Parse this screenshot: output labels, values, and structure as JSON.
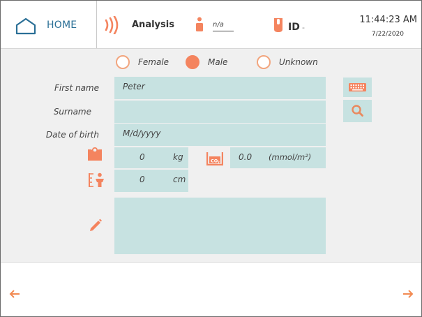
{
  "header": {
    "home_label": "HOME",
    "analysis_label": "Analysis",
    "patient_value": "n/a",
    "id_label": "ID",
    "id_value": "-",
    "time": "11:44:23 AM",
    "date": "7/22/2020"
  },
  "gender": {
    "options": [
      "Female",
      "Male",
      "Unknown"
    ],
    "selected": "Male"
  },
  "form": {
    "first_name_label": "First name",
    "first_name_value": "Peter",
    "surname_label": "Surname",
    "surname_value": "",
    "dob_label": "Date of birth",
    "dob_placeholder": "M/d/yyyy",
    "weight_value": "0",
    "weight_unit": "kg",
    "co2_value": "0.0",
    "co2_unit": "(mmol/m²)",
    "height_value": "0",
    "height_unit": "cm",
    "notes_value": ""
  },
  "icons": {
    "home": "home-icon",
    "analysis": "wave-signal-icon",
    "patient": "person-icon",
    "sample": "tube-icon",
    "keyboard": "keyboard-icon",
    "search": "search-icon",
    "weight": "weight-scale-icon",
    "co2": "co2-icon",
    "height": "height-person-icon",
    "notes": "pencil-icon",
    "back": "arrow-left-icon",
    "next": "arrow-right-icon"
  },
  "colors": {
    "accent": "#f4845f",
    "field_bg": "#c7e2e1",
    "home_blue": "#2a6f96",
    "search_icon": "#e9895e"
  }
}
